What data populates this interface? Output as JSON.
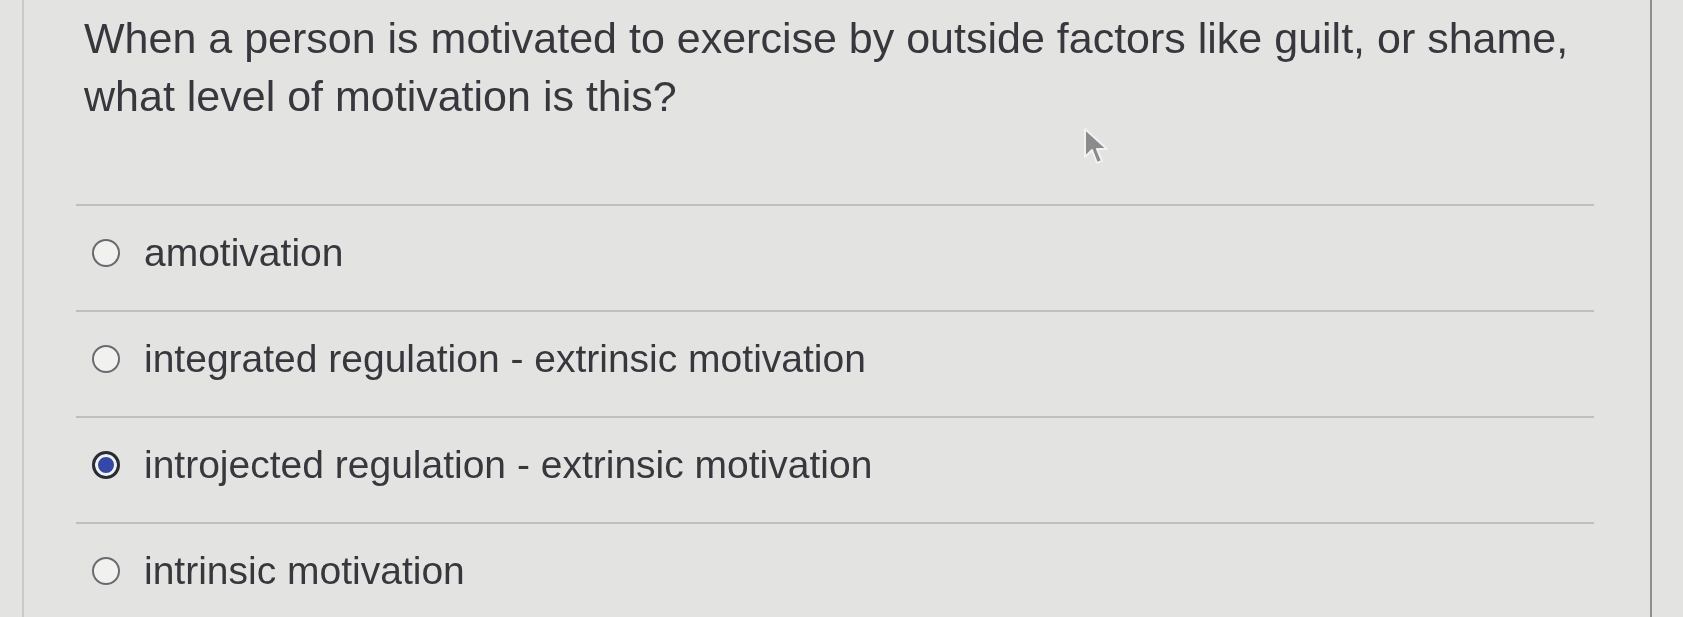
{
  "question": {
    "text": "When a person is motivated to exercise by outside factors like guilt, or shame, what level of motivation is this?"
  },
  "options": [
    {
      "label": "amotivation",
      "selected": false
    },
    {
      "label": "integrated regulation - extrinsic motivation",
      "selected": false
    },
    {
      "label": "introjected regulation - extrinsic motivation",
      "selected": true
    },
    {
      "label": "intrinsic motivation",
      "selected": false
    }
  ]
}
